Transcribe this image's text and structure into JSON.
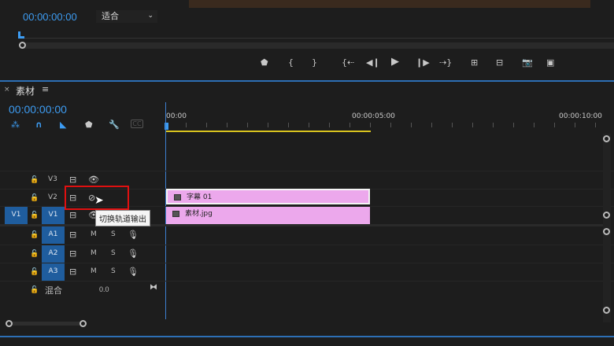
{
  "monitor": {
    "timecode": "00:00:00:00",
    "zoom_select": "适合",
    "controls": [
      "add-marker",
      "mark-in",
      "mark-out",
      "go-to-in",
      "step-back",
      "play",
      "step-forward",
      "go-to-out",
      "insert",
      "overwrite",
      "export-frame",
      "compare"
    ]
  },
  "timeline": {
    "panel_title": "素材",
    "timecode": "00:00:00:00",
    "ruler": [
      "00:00",
      "00:00:05:00",
      "00:00:10:00"
    ],
    "video_tracks": [
      {
        "name": "V3"
      },
      {
        "name": "V2"
      },
      {
        "name": "V1",
        "source": "V1"
      }
    ],
    "audio_tracks": [
      {
        "name": "A1",
        "m": "M",
        "s": "S"
      },
      {
        "name": "A2",
        "m": "M",
        "s": "S"
      },
      {
        "name": "A3",
        "m": "M",
        "s": "S"
      }
    ],
    "mix": {
      "label": "混合",
      "value": "0.0"
    },
    "clips": [
      {
        "track": "V2",
        "name": "字幕 01"
      },
      {
        "track": "V1",
        "name": "素材.jpg"
      }
    ],
    "tooltip": "切换轨道输出",
    "accent": "#3d9cf2",
    "clip_color": "#eca8ec"
  }
}
